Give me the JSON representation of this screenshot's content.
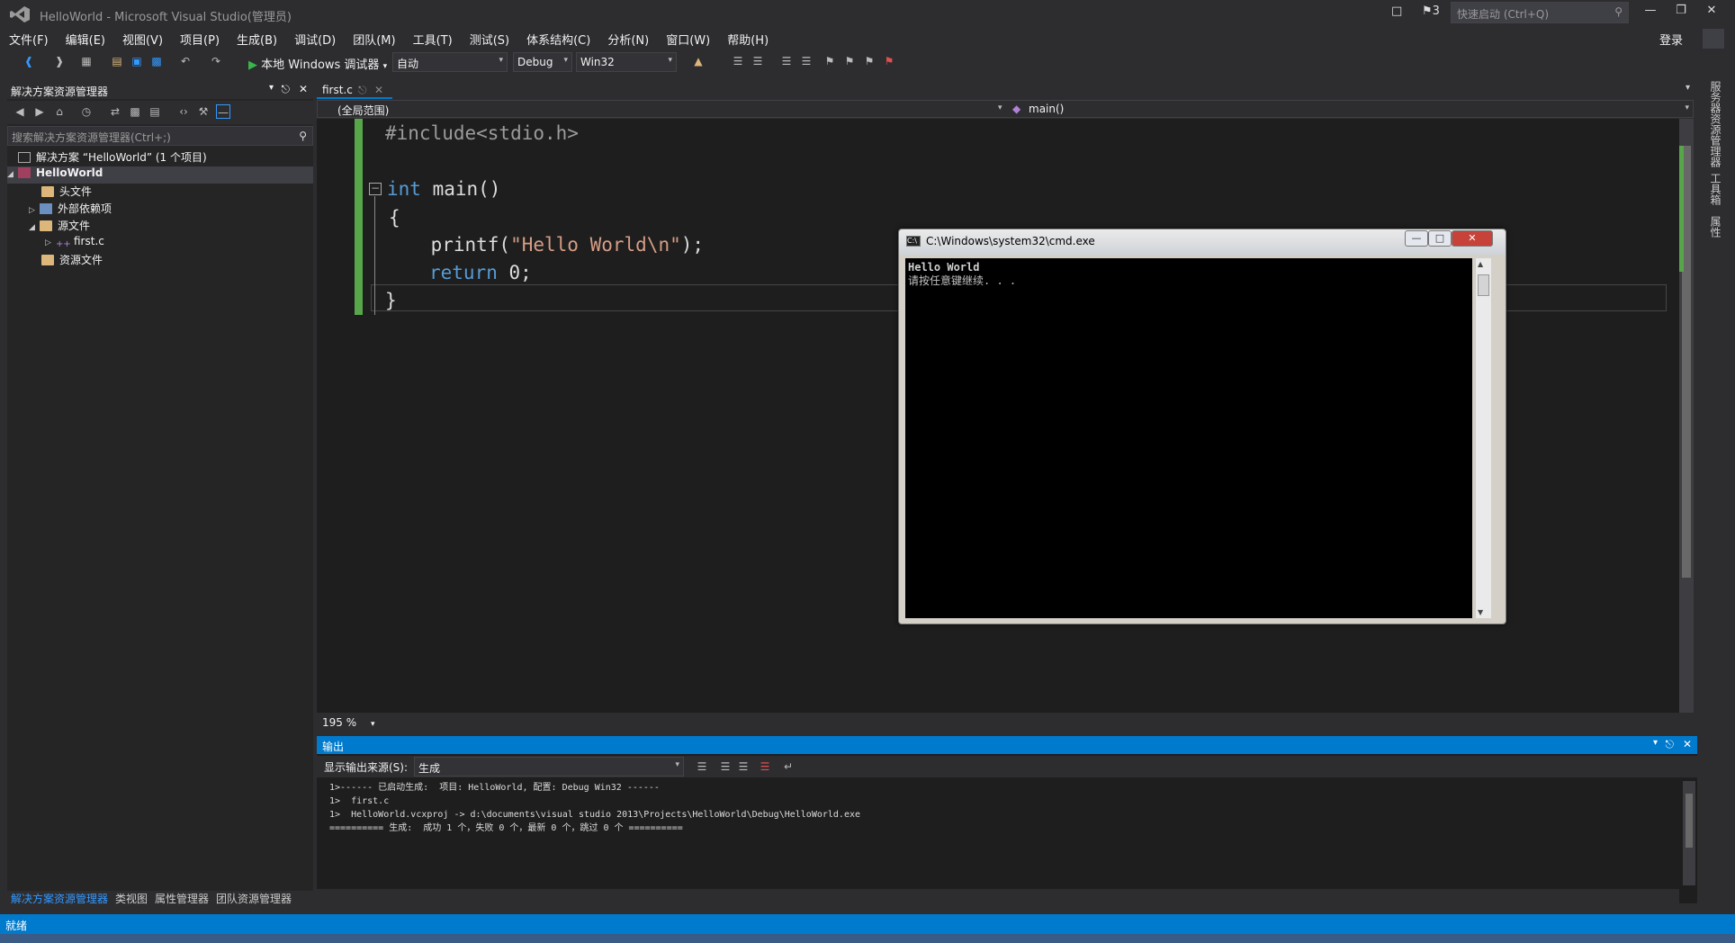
{
  "window": {
    "title": "HelloWorld - Microsoft Visual Studio(管理员)",
    "notification_count": "3",
    "quick_launch_placeholder": "快速启动 (Ctrl+Q)",
    "login": "登录"
  },
  "menu": [
    "文件(F)",
    "编辑(E)",
    "视图(V)",
    "项目(P)",
    "生成(B)",
    "调试(D)",
    "团队(M)",
    "工具(T)",
    "测试(S)",
    "体系结构(C)",
    "分析(N)",
    "窗口(W)",
    "帮助(H)"
  ],
  "toolbar": {
    "run_label": "本地 Windows 调试器",
    "config_auto": "自动",
    "config": "Debug",
    "platform": "Win32"
  },
  "solution_explorer": {
    "title": "解决方案资源管理器",
    "search_placeholder": "搜索解决方案资源管理器(Ctrl+;)",
    "solution": "解决方案 “HelloWorld” (1 个项目)",
    "project": "HelloWorld",
    "items": [
      "头文件",
      "外部依赖项",
      "源文件",
      "first.c",
      "资源文件"
    ],
    "bottom_tabs": [
      "解决方案资源管理器",
      "类视图",
      "属性管理器",
      "团队资源管理器"
    ]
  },
  "editor": {
    "tab": "first.c",
    "scope": "(全局范围)",
    "function": "main()",
    "zoom": "195 %",
    "code": {
      "line1": "#include<stdio.h>",
      "line3_kw": "int",
      "line3_rest": " main()",
      "line4": "{",
      "line5_fn": "    printf(",
      "line5_str": "\"Hello World\\n\"",
      "line5_end": ");",
      "line6_kw": "return",
      "line6_rest": " 0;",
      "line7": "}"
    }
  },
  "output": {
    "title": "输出",
    "source_label": "显示输出来源(S):",
    "source_value": "生成",
    "lines": [
      "1>------ 已启动生成:  项目: HelloWorld, 配置: Debug Win32 ------",
      "1>  first.c",
      "1>  HelloWorld.vcxproj -> d:\\documents\\visual studio 2013\\Projects\\HelloWorld\\Debug\\HelloWorld.exe",
      "========== 生成:  成功 1 个，失败 0 个，最新 0 个，跳过 0 个 =========="
    ]
  },
  "status": "就绪",
  "right_tabs": [
    "服务器资源管理器",
    "工具箱",
    "属性"
  ],
  "cmd": {
    "title": "C:\\Windows\\system32\\cmd.exe",
    "line1": "Hello World",
    "line2": "请按任意键继续. . ."
  }
}
